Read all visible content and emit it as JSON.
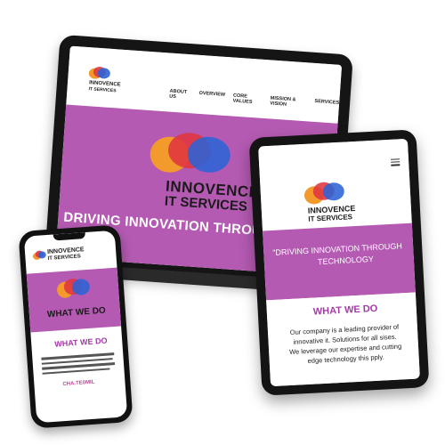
{
  "brand": {
    "line1": "INNOVENCE",
    "line2": "IT SERVICES",
    "colors": {
      "orange": "#f39a2c",
      "red": "#e0363f",
      "blue": "#2c63d6",
      "purple": "#b45ab2",
      "heading_purple": "#a33aa6"
    }
  },
  "laptop": {
    "nav": [
      "ABOUT US",
      "OVERVIEW",
      "CORE VALUES",
      "MISSION & VISION",
      "SERVICES"
    ],
    "tagline": "DRIVING INNOVATION THROUGH TE"
  },
  "tablet": {
    "menu_icon": "hamburger-menu-icon",
    "tagline_line1": "\"DRIVING INNOVATION THROUGH",
    "tagline_line2": "TECHNOLOGY",
    "section_title": "WHAT WE DO",
    "body_lines": [
      "Our company is a leading provider of",
      "innovative it. Solutions for all sises.",
      "We leverage our expertise and cutting",
      "edge technology this pply."
    ]
  },
  "phone": {
    "hero_title": "WHAT WE DO",
    "section_title": "WHAT WE DO",
    "cta": "CHA.TE0MIL"
  }
}
